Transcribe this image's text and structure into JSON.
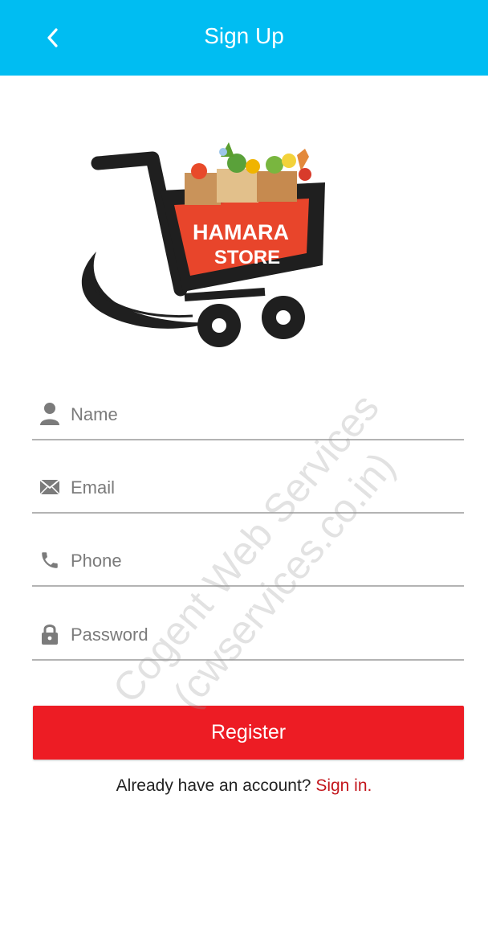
{
  "app_bar": {
    "title": "Sign Up",
    "back_icon": "chevron-left-icon",
    "color": "#00bdf2"
  },
  "logo": {
    "line1": "HAMARA",
    "line2": "STORE",
    "brand_color": "#e8452b"
  },
  "form": {
    "name": {
      "placeholder": "Name",
      "icon": "person-icon"
    },
    "email": {
      "placeholder": "Email",
      "icon": "envelope-icon"
    },
    "phone": {
      "placeholder": "Phone",
      "icon": "phone-icon"
    },
    "password": {
      "placeholder": "Password",
      "icon": "lock-icon"
    }
  },
  "register_button": {
    "label": "Register",
    "color": "#ed1c24"
  },
  "signin": {
    "prompt": "Already have an account?",
    "link": "Sign in.",
    "link_color": "#c3161c"
  },
  "watermark": {
    "line1": "Cogent Web Services",
    "line2": "(cwservices.co.in)"
  }
}
